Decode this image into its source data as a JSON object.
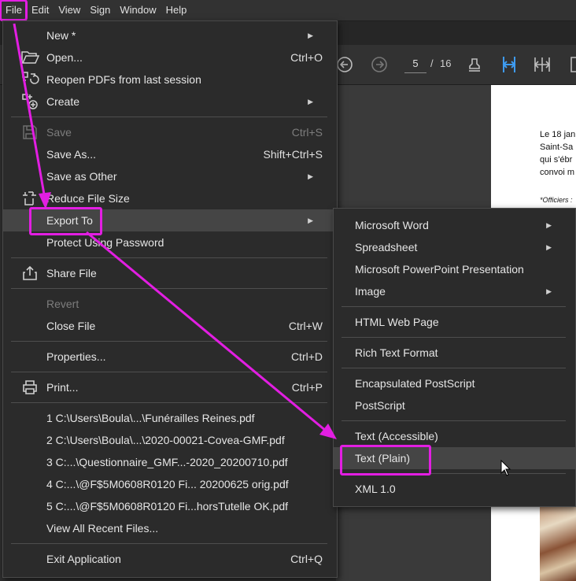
{
  "menubar": [
    "File",
    "Edit",
    "View",
    "Sign",
    "Window",
    "Help"
  ],
  "toolbar": {
    "current_page": "5",
    "separator": "/",
    "total_pages": "16"
  },
  "document": {
    "lines": [
      "Le 18 jan",
      "Saint-Sa",
      "qui s'ébr",
      "convoi m"
    ],
    "note": "*Officiers :"
  },
  "file_menu": {
    "new": "New *",
    "open": "Open...",
    "open_shortcut": "Ctrl+O",
    "reopen": "Reopen PDFs from last session",
    "create": "Create",
    "save": "Save",
    "save_shortcut": "Ctrl+S",
    "save_as": "Save As...",
    "save_as_shortcut": "Shift+Ctrl+S",
    "save_as_other": "Save as Other",
    "reduce": "Reduce File Size",
    "export_to": "Export To",
    "protect": "Protect Using Password",
    "share": "Share File",
    "revert": "Revert",
    "close": "Close File",
    "close_shortcut": "Ctrl+W",
    "properties": "Properties...",
    "properties_shortcut": "Ctrl+D",
    "print": "Print...",
    "print_shortcut": "Ctrl+P",
    "recent": [
      "1 C:\\Users\\Boula\\...\\Funérailles Reines.pdf",
      "2 C:\\Users\\Boula\\...\\2020-00021-Covea-GMF.pdf",
      "3 C:...\\Questionnaire_GMF...-2020_20200710.pdf",
      "4 C:...\\@F$5M0608R0120 Fi... 20200625 orig.pdf",
      "5 C:...\\@F$5M0608R0120 Fi...horsTutelle OK.pdf"
    ],
    "view_all": "View All Recent Files...",
    "exit": "Exit Application",
    "exit_shortcut": "Ctrl+Q"
  },
  "export_menu": {
    "word": "Microsoft Word",
    "spreadsheet": "Spreadsheet",
    "powerpoint": "Microsoft PowerPoint Presentation",
    "image": "Image",
    "html": "HTML Web Page",
    "rtf": "Rich Text Format",
    "eps": "Encapsulated PostScript",
    "ps": "PostScript",
    "text_accessible": "Text (Accessible)",
    "text_plain": "Text (Plain)",
    "xml": "XML 1.0"
  },
  "annotation_color": "#e21ee2"
}
